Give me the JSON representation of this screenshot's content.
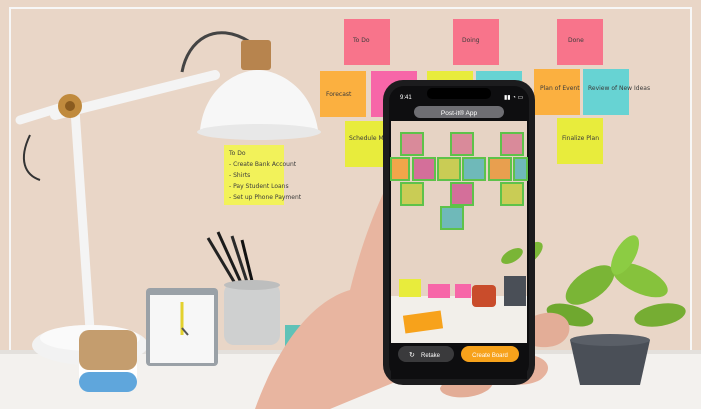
{
  "wall": {
    "top_notes": [
      {
        "text": "To Do",
        "color": "#f8748b"
      },
      {
        "text": "Doing",
        "color": "#f8748b"
      },
      {
        "text": "Done",
        "color": "#f8748b"
      }
    ],
    "row_notes": [
      {
        "text": "Forecast",
        "color": "#fbb040"
      },
      {
        "text": "",
        "color": "#f766a8"
      },
      {
        "text": "",
        "color": "#e8ec3c"
      },
      {
        "text": "",
        "color": "#67d3d3"
      },
      {
        "text": "Plan of Event",
        "color": "#fbb040"
      },
      {
        "text": "Review of New Ideas",
        "color": "#67d3d3"
      }
    ],
    "lower_notes": [
      {
        "text": "Schedule Meeting w/ Team",
        "color": "#e8ec3c"
      },
      {
        "text": "Finalize Plan",
        "color": "#e8ec3c"
      }
    ],
    "lamp_note": {
      "lines": [
        "To Do",
        "- Create Bank Account",
        "- Shirts",
        "- Pay Student Loans",
        "- Set up Phone Payment"
      ],
      "color": "#f2f25a"
    }
  },
  "phone": {
    "status_time": "9:41",
    "app_title": "Post-it® App",
    "retake_label": "Retake",
    "create_label": "Create Board",
    "accent_color": "#f7a21b"
  },
  "colors": {
    "wall": "#e9d6c7",
    "desk": "#f3f1ee",
    "detect_outline": "#5ec24a"
  }
}
